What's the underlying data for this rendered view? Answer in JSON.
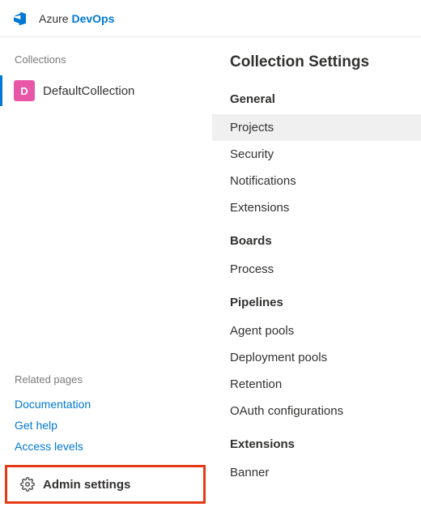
{
  "brand": {
    "part1": "Azure ",
    "part2": "DevOps"
  },
  "left": {
    "collections_label": "Collections",
    "collection": {
      "badge": "D",
      "name": "DefaultCollection"
    },
    "related_label": "Related pages",
    "links": {
      "documentation": "Documentation",
      "get_help": "Get help",
      "access_levels": "Access levels"
    },
    "admin_settings_label": "Admin settings"
  },
  "right": {
    "title": "Collection Settings",
    "groups": [
      {
        "heading": "General",
        "items": [
          {
            "label": "Projects",
            "selected": true
          },
          {
            "label": "Security",
            "selected": false
          },
          {
            "label": "Notifications",
            "selected": false
          },
          {
            "label": "Extensions",
            "selected": false
          }
        ]
      },
      {
        "heading": "Boards",
        "items": [
          {
            "label": "Process",
            "selected": false
          }
        ]
      },
      {
        "heading": "Pipelines",
        "items": [
          {
            "label": "Agent pools",
            "selected": false
          },
          {
            "label": "Deployment pools",
            "selected": false
          },
          {
            "label": "Retention",
            "selected": false
          },
          {
            "label": "OAuth configurations",
            "selected": false
          }
        ]
      },
      {
        "heading": "Extensions",
        "items": [
          {
            "label": "Banner",
            "selected": false
          }
        ]
      }
    ]
  }
}
